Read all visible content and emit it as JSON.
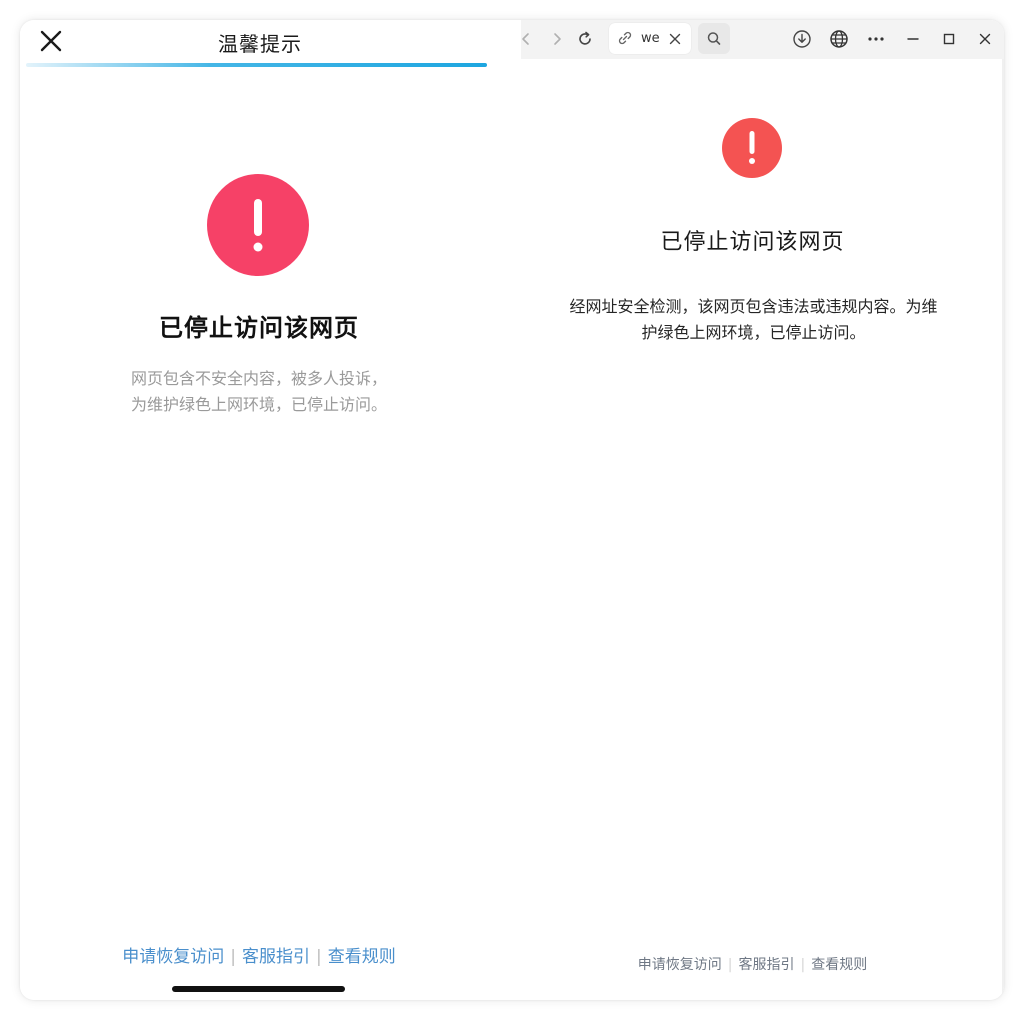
{
  "left_panel": {
    "title": "温馨提示",
    "heading": "已停止访问该网页",
    "desc_line1": "网页包含不安全内容，被多人投诉，",
    "desc_line2": "为维护绿色上网环境，已停止访问。",
    "links": {
      "restore": "申请恢复访问",
      "sep": "|",
      "support": "客服指引",
      "rules": "查看规则"
    },
    "alert_color": "#f64167",
    "accent_color": "#1da6e0"
  },
  "browser": {
    "tab": {
      "title": "we"
    },
    "icons": [
      "back-icon",
      "forward-icon",
      "reload-icon",
      "link-icon",
      "close-icon",
      "search-icon",
      "download-icon",
      "globe-icon",
      "more-icon",
      "minimize-icon",
      "maximize-icon",
      "close-window-icon"
    ],
    "page": {
      "heading": "已停止访问该网页",
      "desc_line1": "经网址安全检测，该网页包含违法或违规内容。为维",
      "desc_line2": "护绿色上网环境，已停止访问。",
      "links": {
        "restore": "申请恢复访问",
        "sep": "|",
        "support": "客服指引",
        "rules": "查看规则"
      },
      "alert_color": "#f45352"
    }
  }
}
